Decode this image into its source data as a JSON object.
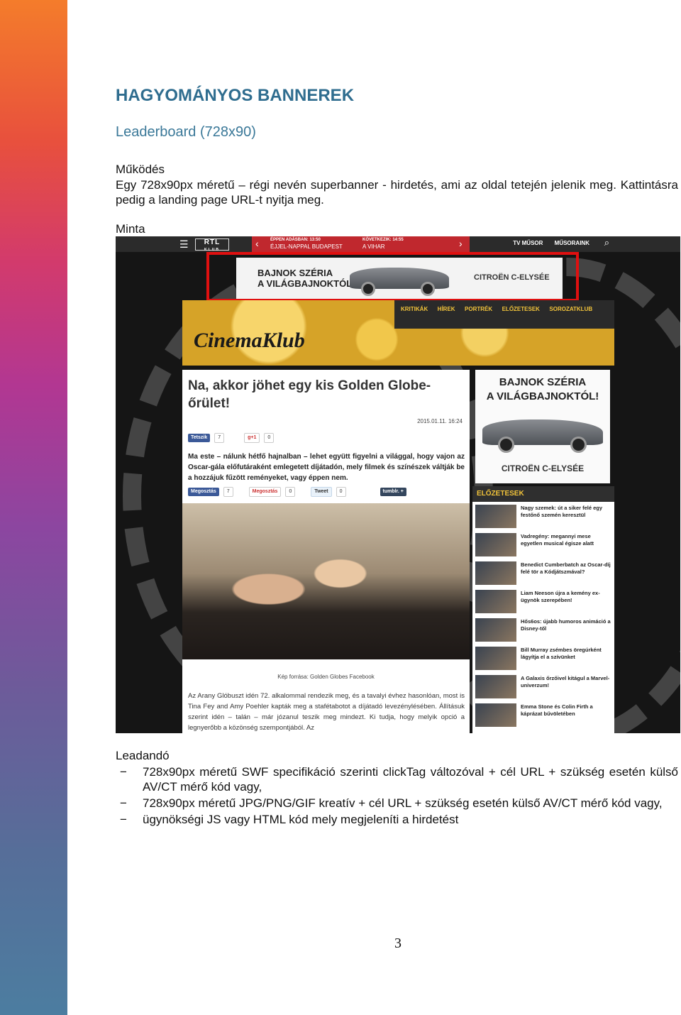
{
  "heading": "HAGYOMÁNYOS BANNEREK",
  "subheading": "Leaderboard (728x90)",
  "section_mukodes": "Működés",
  "description": "Egy 728x90px méretű – régi nevén superbanner - hirdetés, ami az oldal tetején jelenik meg. Kattintásra pedig a landing page URL-t nyitja meg.",
  "section_minta": "Minta",
  "section_leadando": "Leadandó",
  "deliverables": [
    "728x90px méretű SWF specifikáció szerinti clickTag változóval + cél URL + szükség esetén külső AV/CT mérő kód vagy,",
    "728x90px méretű JPG/PNG/GIF kreatív + cél URL + szükség esetén külső AV/CT mérő kód vagy,",
    "ügynökségi JS vagy HTML kód mely megjeleníti a hirdetést"
  ],
  "bullet_mark": "−",
  "page_number": "3",
  "screenshot": {
    "rtl_logo": "RTL",
    "rtl_sub": "KLUB",
    "now_label": "ÉPPEN ADÁSBAN: 13:50",
    "now_title": "ÉJJEL-NAPPAL BUDAPEST",
    "next_label": "KÖVETKEZIK: 14:55",
    "next_title": "A VIHAR",
    "tv_links": [
      "TV MŰSOR",
      "MŰSORAINK"
    ],
    "ad_slogan_1": "BAJNOK SZÉRIA",
    "ad_slogan_2": "A VILÁGBAJNOKTÓL!",
    "ad_brand": "CITROËN C-ELYSÉE",
    "cinema_logo": "CinemaKlub",
    "cinema_nav": [
      "KRITIKÁK",
      "HÍREK",
      "PORTRÉK",
      "ELŐZETESEK",
      "SOROZATKLUB"
    ],
    "article_title": "Na, akkor jöhet egy kis Golden Globe-őrület!",
    "article_date": "2015.01.11. 16:24",
    "like_label": "Tetszik",
    "like_count": "7",
    "gplus_label": "g+1",
    "gplus_count": "0",
    "lead": "Ma este – nálunk hétfő hajnalban – lehet együtt figyelni a világgal, hogy vajon az Oscar-gála előfutáraként emlegetett díjátadón, mely filmek és színészek váltják be a hozzájuk fűzött reményeket, vagy éppen nem.",
    "share_label": "Megosztás",
    "share_count": "7",
    "gshare_label": "Megosztás",
    "gshare_count": "0",
    "tweet_label": "Tweet",
    "tweet_count": "0",
    "tumblr_label": "tumblr. +",
    "caption": "Kép forrása: Golden Globes Facebook",
    "body": "Az Arany Glóbuszt idén 72. alkalommal rendezik meg, és a tavalyi évhez hasonlóan, most is Tina Fey and Amy Poehler kapták meg a stafétabotot a díjátadó levezénylésében. Állításuk szerint idén – talán – már józanul teszik meg mindezt. Ki tudja, hogy melyik opció a legnyerőbb a közönség szempontjából. Az",
    "previews_title": "ELŐZETESEK",
    "previews": [
      "Nagy szemek: út a siker felé egy festőnő szemén keresztül",
      "Vadregény: megannyi mese egyetlen musical égisze alatt",
      "Benedict Cumberbatch az Oscar-díj felé tör a Kódjátszmával?",
      "Liam Neeson újra a kemény ex-ügynök szerepében!",
      "Hős6os: újabb humoros animáció a Disney-től",
      "Bill Murray zsémbes öregúrként lágyítja el a szívünket",
      "A Galaxis őrzőivel kitágul a Marvel-univerzum!",
      "Emma Stone és Colin Firth a káprázat bűvöletében"
    ]
  }
}
